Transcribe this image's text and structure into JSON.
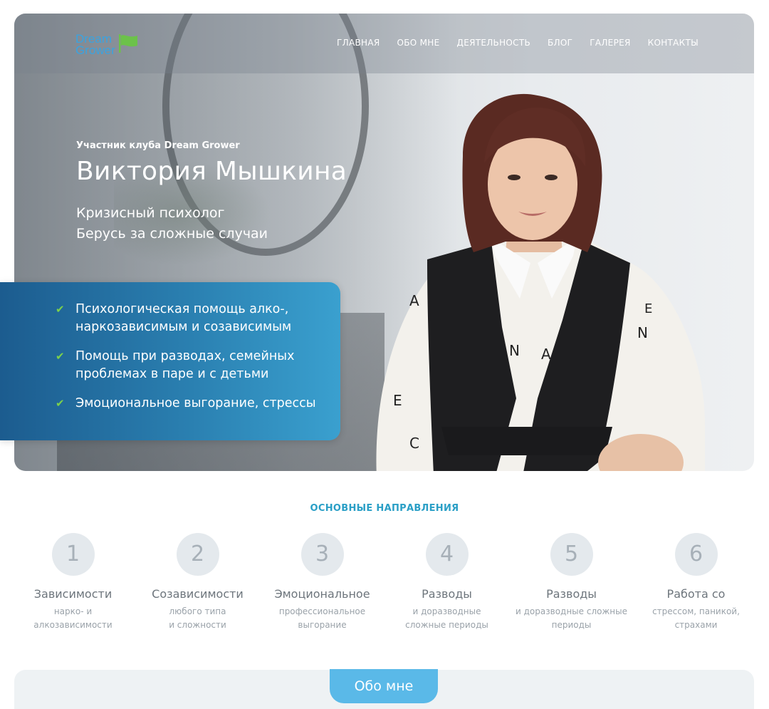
{
  "brand": {
    "logo_line1": "Dream",
    "logo_line2": "Grower"
  },
  "nav": {
    "items": [
      "ГЛАВНАЯ",
      "ОБО МНЕ",
      "ДЕЯТЕЛЬНОСТЬ",
      "БЛОГ",
      "ГАЛЕРЕЯ",
      "КОНТАКТЫ"
    ]
  },
  "hero": {
    "kicker": "Участник клуба Dream Grower",
    "name": "Виктория Мышкина",
    "role_line1": "Кризисный психолог",
    "role_line2": "Берусь за сложные случаи"
  },
  "services": [
    {
      "line1": "Психологическая помощь алко-,",
      "line2": "наркозависимым и созависимым"
    },
    {
      "line1": "Помощь при разводах, семейных",
      "line2": "проблемах в паре и с детьми"
    },
    {
      "line1": "Эмоциональное выгорание, стрессы",
      "line2": ""
    }
  ],
  "directions": {
    "title": "ОСНОВНЫЕ НАПРАВЛЕНИЯ",
    "items": [
      {
        "num": "1",
        "title": "Зависимости",
        "d1": "нарко- и",
        "d2": "алкозависимости"
      },
      {
        "num": "2",
        "title": "Созависимости",
        "d1": "любого типа",
        "d2": "и сложности"
      },
      {
        "num": "3",
        "title": "Эмоциональное",
        "d1": "профессиональное",
        "d2": "выгорание"
      },
      {
        "num": "4",
        "title": "Разводы",
        "d1": "и доразводные",
        "d2": "сложные периоды"
      },
      {
        "num": "5",
        "title": "Разводы",
        "d1": "и доразводные сложные",
        "d2": "периоды"
      },
      {
        "num": "6",
        "title": "Работа со",
        "d1": "стрессом, паникой,",
        "d2": "страхами"
      }
    ]
  },
  "about": {
    "button_label": "Обо мне"
  },
  "colors": {
    "accent": "#2a9fc6",
    "check": "#7cd14b",
    "logo": "#3aa3e0",
    "panel": "#2a7fb0",
    "about_button": "#5ab9e8"
  }
}
